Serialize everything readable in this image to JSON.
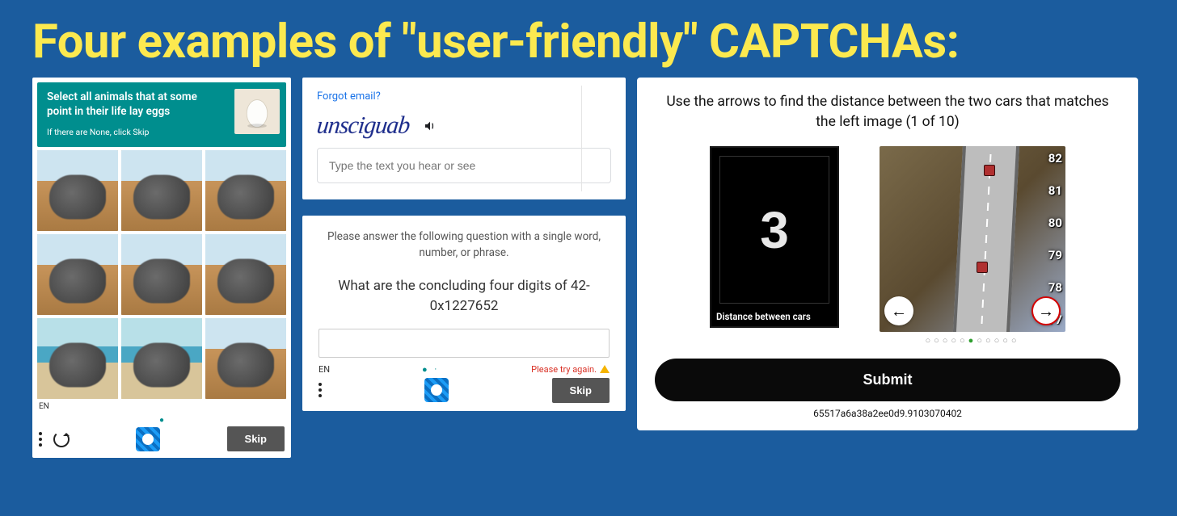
{
  "title": "Four examples of \"user-friendly\" CAPTCHAs:",
  "captcha1": {
    "instruction": "Select all animals that at some point in their life lay eggs",
    "sub_instruction": "If there are None, click Skip",
    "reference_icon": "egg-icon",
    "tiles": [
      {
        "kind": "dino-desert"
      },
      {
        "kind": "horse-desert"
      },
      {
        "kind": "camel-desert"
      },
      {
        "kind": "elephant-desert"
      },
      {
        "kind": "elephant-desert"
      },
      {
        "kind": "elephant-desert"
      },
      {
        "kind": "dino-beach"
      },
      {
        "kind": "elephant-beach"
      },
      {
        "kind": "elephantseal-desert"
      }
    ],
    "lang": "EN",
    "page_dots": "●",
    "skip_label": "Skip"
  },
  "captcha2": {
    "forgot_link": "Forgot email?",
    "distorted_text": "unsciguab",
    "input_placeholder": "Type the text you hear or see"
  },
  "captcha3": {
    "prompt": "Please answer the following question with a single word, number, or phrase.",
    "question": "What are the concluding four digits of 42-0x1227652",
    "lang": "EN",
    "page_dots": "● ·",
    "error_text": "Please try again.",
    "skip_label": "Skip"
  },
  "captcha4": {
    "instruction": "Use the arrows to find the distance between the two cars that matches the left image (1 of 10)",
    "left_number": "3",
    "left_caption": "Distance between cars",
    "scale_values": [
      "82",
      "81",
      "80",
      "79",
      "78",
      "77"
    ],
    "progress_total": 11,
    "progress_current": 5,
    "submit_label": "Submit",
    "hash": "65517a6a38a2ee0d9.9103070402"
  }
}
